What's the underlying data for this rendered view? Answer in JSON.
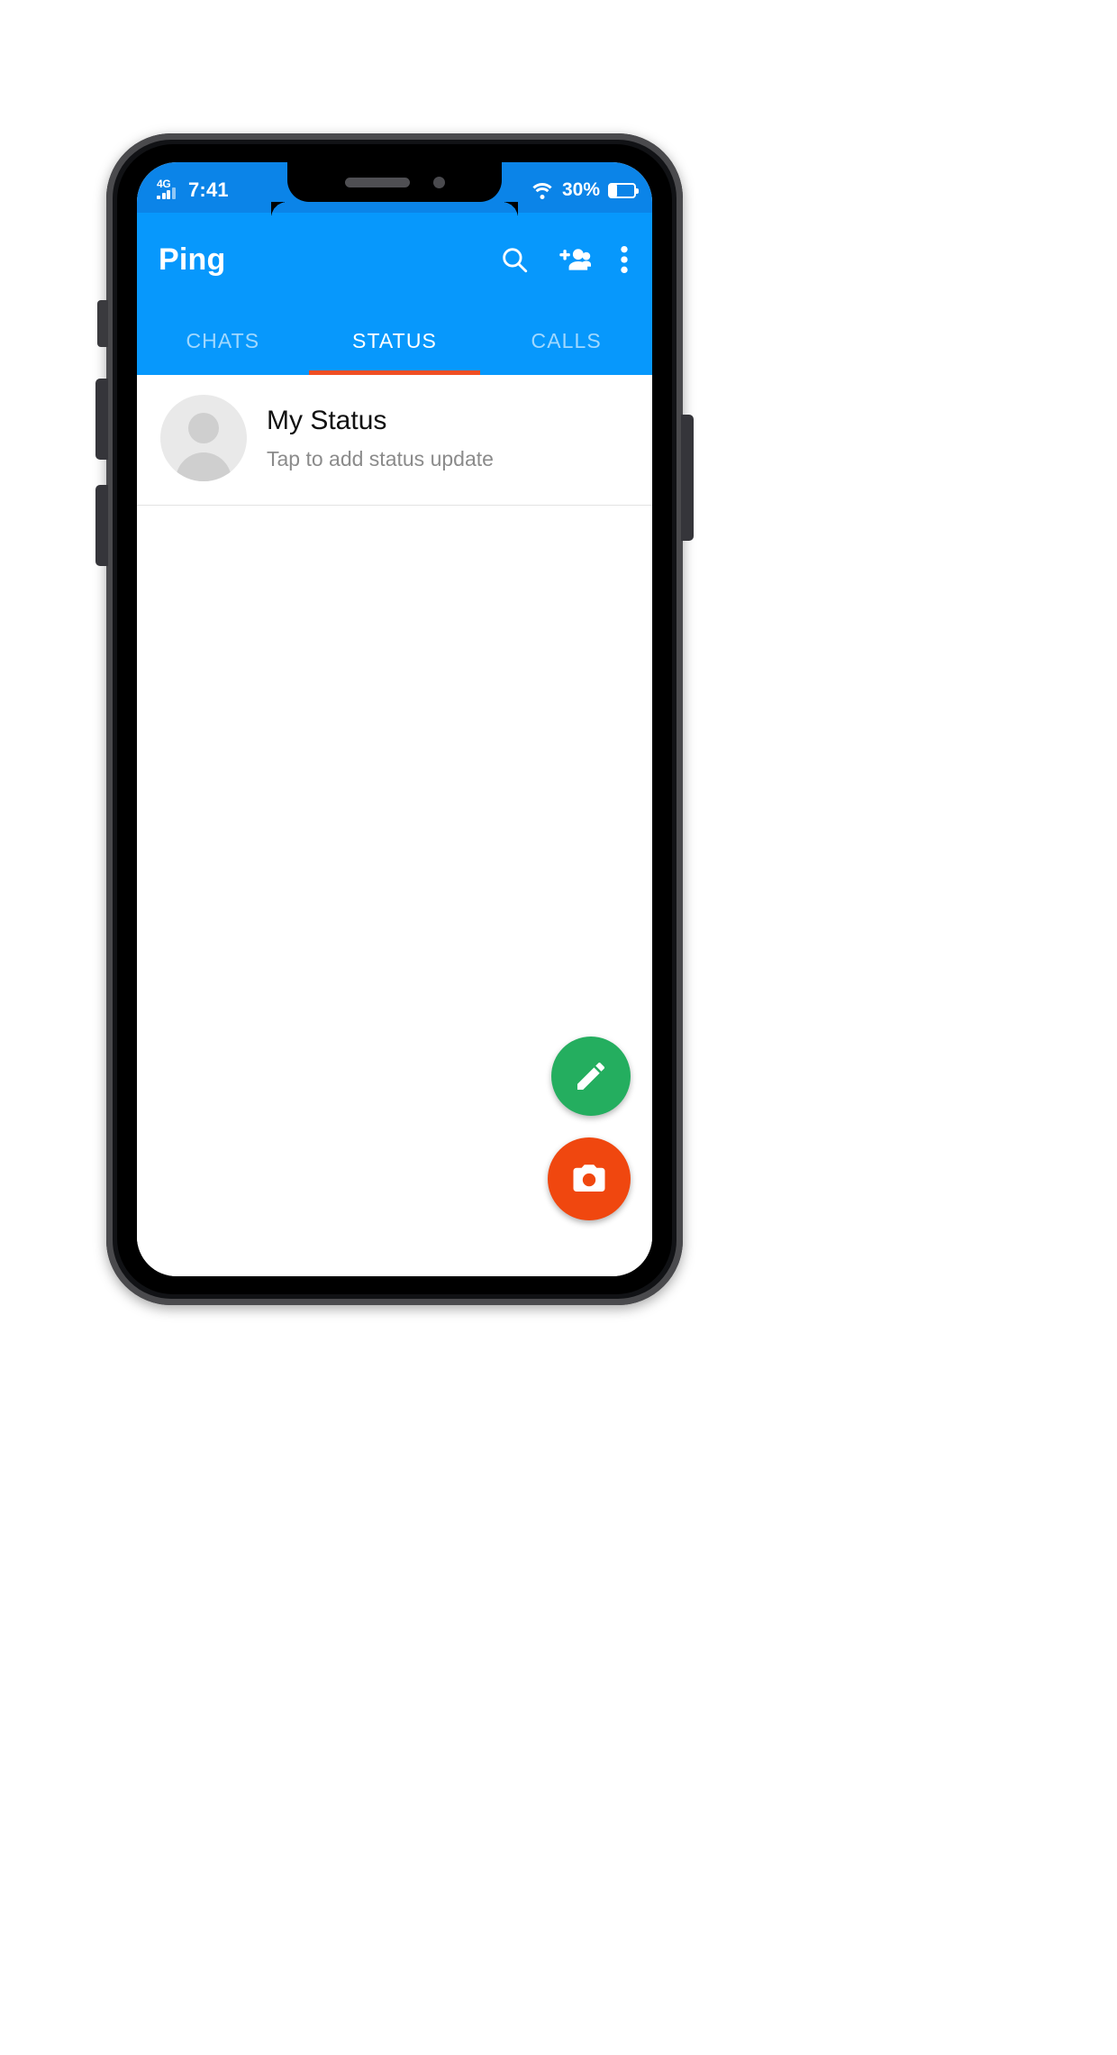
{
  "device": {
    "type": "smartphone-mockup",
    "frame_color": "#4a4a4d"
  },
  "status_bar": {
    "network_label": "4G",
    "time": "7:41",
    "battery_percent": "30%",
    "battery_level": 30,
    "icons": {
      "signal": "signal-bars-icon",
      "wifi": "wifi-icon",
      "battery": "battery-icon"
    },
    "background_color": "#0B84E8"
  },
  "app_bar": {
    "title": "Ping",
    "background_color": "#0798FC",
    "actions": [
      {
        "name": "search-icon",
        "label": "Search"
      },
      {
        "name": "add-person-icon",
        "label": "New group"
      },
      {
        "name": "overflow-menu-icon",
        "label": "More options"
      }
    ]
  },
  "tabs": {
    "items": [
      {
        "label": "CHATS",
        "active": false
      },
      {
        "label": "STATUS",
        "active": true
      },
      {
        "label": "CALLS",
        "active": false
      }
    ],
    "active_index": 1,
    "indicator_color": "#F04E23"
  },
  "content": {
    "my_status": {
      "title": "My Status",
      "subtitle": "Tap to add status update"
    }
  },
  "fabs": [
    {
      "name": "edit-fab",
      "icon": "pencil-icon",
      "color": "#24AE5F"
    },
    {
      "name": "camera-fab",
      "icon": "camera-icon",
      "color": "#F0470F"
    }
  ],
  "colors": {
    "primary": "#0798FC",
    "status_bar": "#0B84E8",
    "accent_orange": "#F04E23",
    "fab_green": "#24AE5F",
    "fab_orange": "#F0470F",
    "text_primary": "#111111",
    "text_secondary": "#8b8b8b"
  }
}
